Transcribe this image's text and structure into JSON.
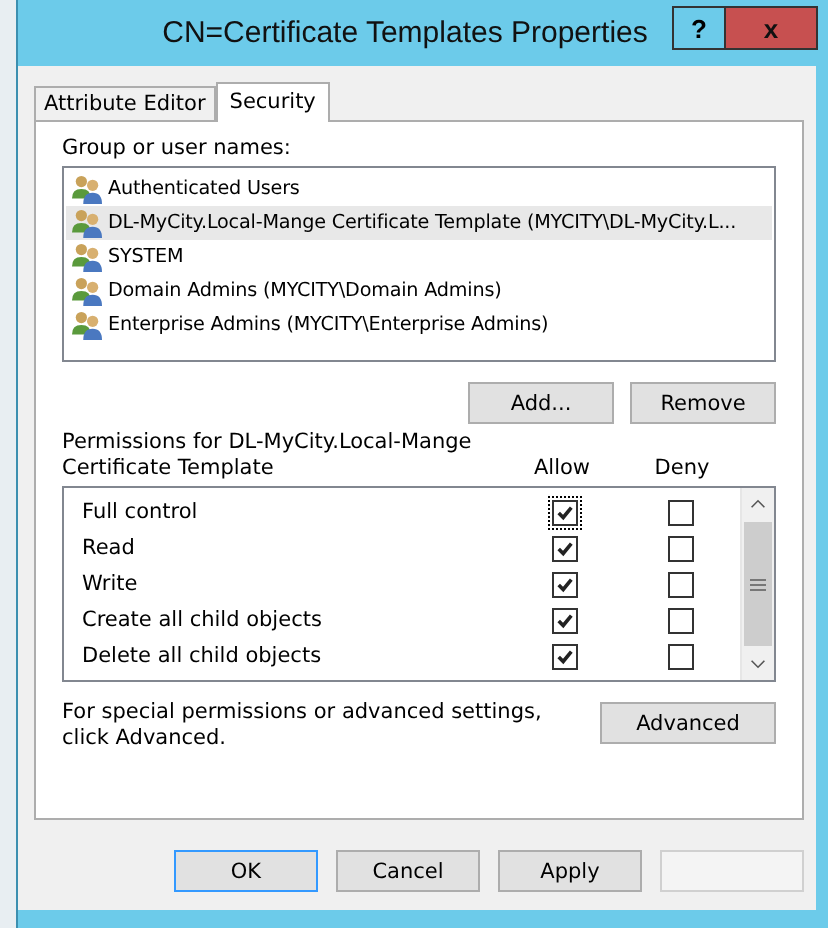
{
  "window": {
    "title": "CN=Certificate Templates Properties",
    "help_label": "?",
    "close_label": "x"
  },
  "tabs": [
    {
      "label": "Attribute Editor",
      "selected": false
    },
    {
      "label": "Security",
      "selected": true
    }
  ],
  "groups_label": "Group or user names:",
  "groups": [
    {
      "name": "Authenticated Users",
      "selected": false
    },
    {
      "name": "DL-MyCity.Local-Mange Certificate Template (MYCITY\\DL-MyCity.L...",
      "selected": true
    },
    {
      "name": "SYSTEM",
      "selected": false
    },
    {
      "name": "Domain Admins (MYCITY\\Domain Admins)",
      "selected": false
    },
    {
      "name": "Enterprise Admins (MYCITY\\Enterprise Admins)",
      "selected": false
    }
  ],
  "group_buttons": [
    "Add...",
    "Remove"
  ],
  "permissions_label": "Permissions for DL-MyCity.Local-Mange Certificate Template",
  "columns": [
    "Allow",
    "Deny"
  ],
  "permissions": [
    {
      "name": "Full control",
      "allow": true,
      "deny": false,
      "focused": true
    },
    {
      "name": "Read",
      "allow": true,
      "deny": false,
      "focused": false
    },
    {
      "name": "Write",
      "allow": true,
      "deny": false,
      "focused": false
    },
    {
      "name": "Create all child objects",
      "allow": true,
      "deny": false,
      "focused": false
    },
    {
      "name": "Delete all child objects",
      "allow": true,
      "deny": false,
      "focused": false
    }
  ],
  "advanced_note": "For special permissions or advanced settings, click Advanced.",
  "advanced_button": "Advanced",
  "buttons": [
    {
      "label": "OK",
      "default": true,
      "disabled": false
    },
    {
      "label": "Cancel",
      "default": false,
      "disabled": false
    },
    {
      "label": "Apply",
      "default": false,
      "disabled": false
    },
    {
      "default": false,
      "disabled": true
    }
  ]
}
